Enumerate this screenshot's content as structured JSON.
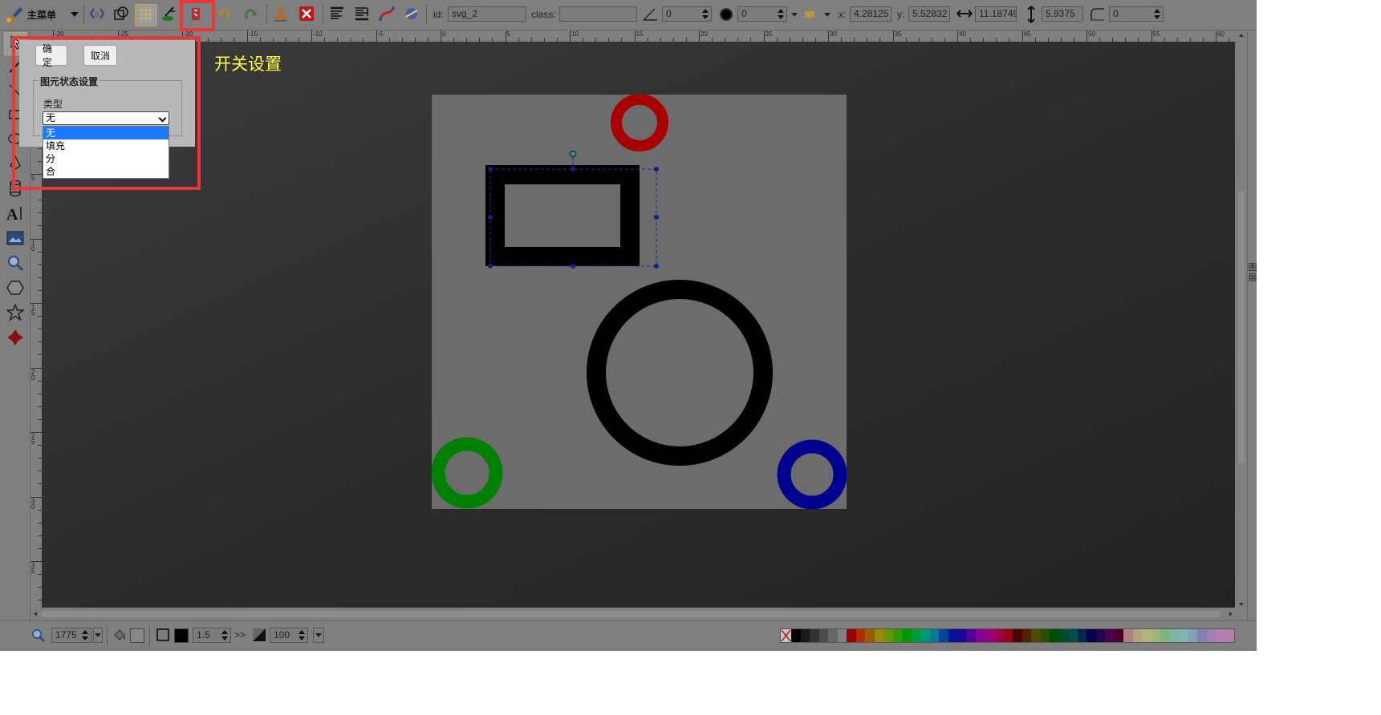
{
  "toolbar": {
    "main_menu_label": "主菜单",
    "id_label": "id:",
    "id_value": "svg_2",
    "class_label": "class:",
    "class_value": "",
    "angle_value": "0",
    "blur_value": "0",
    "x_label": "x:",
    "x_value": "4.28125",
    "y_label": "y:",
    "y_value": "5.52832",
    "width_value": "11.18749",
    "height_value": "5.9375",
    "corner_radius_value": "0"
  },
  "ruler": {
    "horizontal_ticks": [
      "-30",
      "-25",
      "-20",
      "-15",
      "-10",
      "-5",
      "0",
      "5",
      "10",
      "15",
      "20",
      "25",
      "30",
      "35",
      "40",
      "45",
      "50",
      "55",
      "60"
    ],
    "vertical_ticks": [
      "-5",
      "0",
      "5",
      "10",
      "15",
      "20",
      "25",
      "30",
      "35"
    ]
  },
  "dialog": {
    "ok_label": "确定",
    "cancel_label": "取消",
    "section_title": "图元状态设置",
    "type_label": "类型",
    "selected_value": "无",
    "options": [
      "无",
      "填充",
      "分",
      "合"
    ]
  },
  "annotation": {
    "text": "开关设置"
  },
  "right_panel": {
    "layers_label_1": "图",
    "layers_label_2": "层"
  },
  "bottom": {
    "zoom_value": "1775",
    "stroke_width_value": "1.5",
    "opacity_value": "100",
    "arrow_label": ">>"
  },
  "colors": {
    "red_circle": "#a80000",
    "green_circle": "#008000",
    "blue_circle": "#00008e",
    "highlight_box": "#ee3434",
    "annotation_text": "#ffff3c",
    "selected_option": "#1e78ff",
    "palette": [
      "#000000",
      "#1a1a1a",
      "#333333",
      "#4d4d4d",
      "#666666",
      "#808080",
      "#990000",
      "#b32d00",
      "#995c00",
      "#998a00",
      "#669900",
      "#339900",
      "#009900",
      "#00993d",
      "#009973",
      "#007a99",
      "#004799",
      "#001499",
      "#1f0099",
      "#520099",
      "#850099",
      "#99007a",
      "#990047",
      "#990014",
      "#4d0000",
      "#4d2600",
      "#4d4d00",
      "#264d00",
      "#004d00",
      "#004d26",
      "#004d4d",
      "#00264d",
      "#00004d",
      "#26004d",
      "#4d004d",
      "#4d0026",
      "#b38080",
      "#b3a380",
      "#b3b380",
      "#a3b380",
      "#80b380",
      "#80b3a3",
      "#80b3b3",
      "#80a3b3",
      "#8080b3",
      "#a380b3",
      "#b380b3",
      "#b380a3"
    ]
  }
}
